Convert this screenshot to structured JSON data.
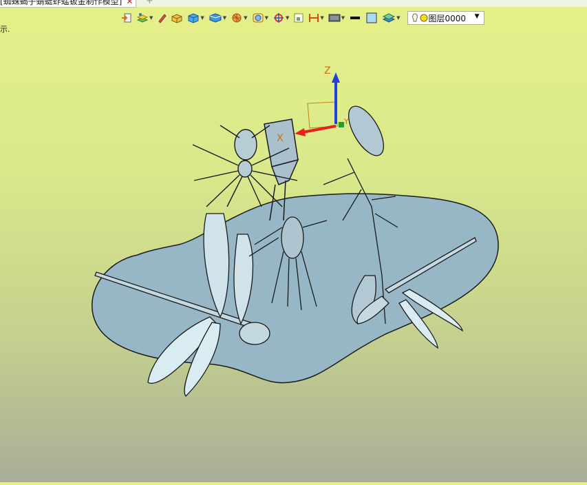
{
  "tab": {
    "title": "[蜘蛛蝎子蜻蜓蚱蜢钣金制作模型]",
    "close_symbol": "✕",
    "add_symbol": "+"
  },
  "hint_text": "示.",
  "toolbar": {
    "icons": [
      "export-icon",
      "layers-manage-icon",
      "pen-icon",
      "box-solid-icon",
      "cube-icon",
      "view-orient-icon",
      "render-style-icon",
      "display-mode-icon",
      "snap-icon",
      "fit-view-icon",
      "dimension-icon",
      "display-settings-icon",
      "line-color-swatch",
      "fill-color-swatch",
      "layer-stack-icon"
    ],
    "layer_select_value": "图层0000",
    "colors": {
      "line_swatch": "#111111",
      "fill_swatch": "#a8dcf0"
    }
  },
  "viewport": {
    "axis_labels": {
      "x": "X",
      "y": "Y",
      "z": "Z"
    },
    "colors": {
      "base_plate": "#97b6c6",
      "outline": "#1a1a1a",
      "axis_x": "#e82020",
      "axis_y": "#20a030",
      "axis_z": "#2040e0"
    }
  }
}
